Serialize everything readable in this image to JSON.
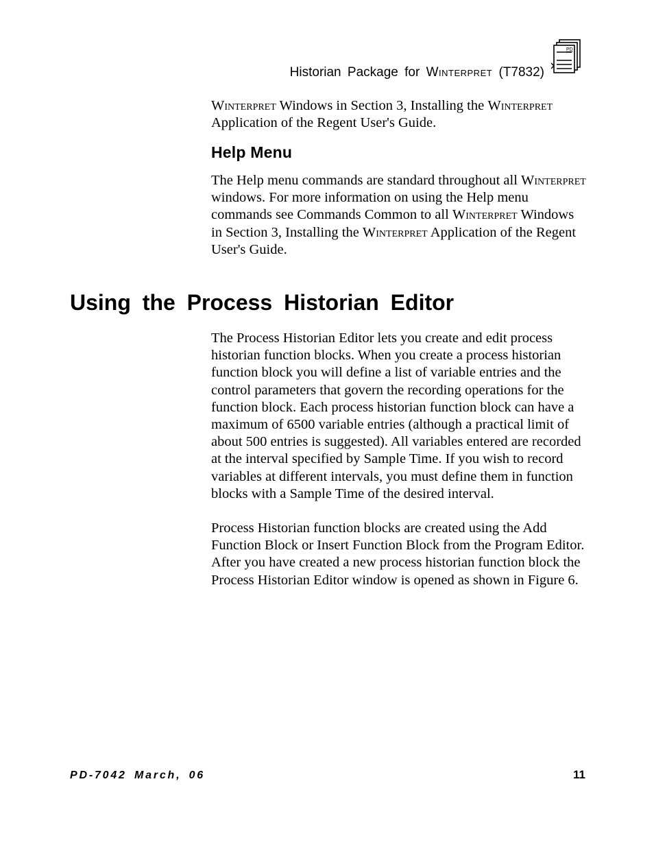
{
  "header": {
    "running_title_pre": "Historian  Package  for ",
    "running_title_sc": "Winterpret",
    "running_title_post": " (T7832)",
    "icon_label": "PD"
  },
  "top_para": {
    "sc1": "Winterpret",
    "t1": " Windows in Section 3, Installing the ",
    "sc2": "Winterpret",
    "t2": " Application of the Regent User's Guide."
  },
  "help": {
    "heading": "Help Menu",
    "t1": "The Help menu commands are standard throughout all ",
    "sc1": "Winterpret",
    "t2": " windows.  For more information on using the Help menu commands see Commands Common to all ",
    "sc2": "Winterpret",
    "t3": " Windows in Section 3, Installing the ",
    "sc3": "Winterpret",
    "t4": " Application of the Regent User's Guide."
  },
  "h1": "Using  the  Process  Historian  Editor",
  "editor": {
    "p1": "The Process Historian Editor lets you create and edit process historian function blocks.  When you create a process historian function block you will define a list of variable entries and the control parameters that govern the recording operations for the function block.  Each process historian function block can have a maximum of 6500 variable entries (although a practical limit of about 500 entries is suggested).  All variables entered are recorded at the interval specified by Sample Time.  If you wish to record variables at different intervals, you must define them in function blocks with a Sample Time of the desired interval.",
    "p2": "Process Historian function blocks are created using the Add Function Block or Insert Function Block from the Program Editor.  After you have created  a new process historian function block the Process Historian Editor window is opened as shown in Figure 6."
  },
  "footer": {
    "left": "PD-7042 March, 06",
    "right": "11"
  }
}
